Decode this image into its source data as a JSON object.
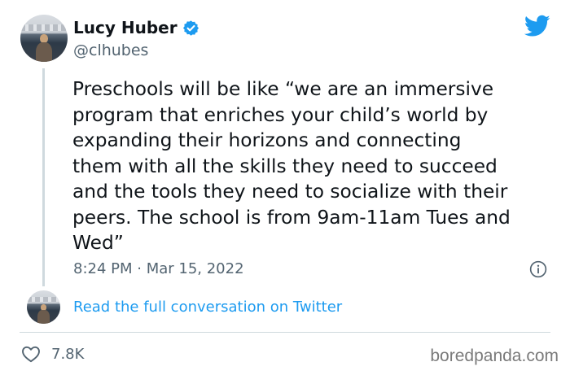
{
  "author": {
    "name": "Lucy Huber",
    "handle": "@clhubes"
  },
  "tweet": {
    "text": "Preschools will be like “we are an immersive\nprogram that enriches your child’s world by\nexpanding their horizons and connecting\nthem with all the skills they need to succeed\nand the tools they need to socialize with their\npeers. The school is from 9am-11am Tues and\nWed”",
    "timestamp": "8:24 PM · Mar 15, 2022"
  },
  "thread": {
    "link_label": "Read the full conversation on Twitter"
  },
  "engagement": {
    "likes": "7.8K"
  },
  "watermark": "boredpanda.com",
  "icons": {
    "verified": "verified-badge-icon",
    "brand": "twitter-bird-icon",
    "info": "info-icon",
    "like": "heart-icon"
  },
  "colors": {
    "link": "#1d9bf0",
    "verified": "#1d9bf0",
    "secondary_text": "#536471"
  }
}
